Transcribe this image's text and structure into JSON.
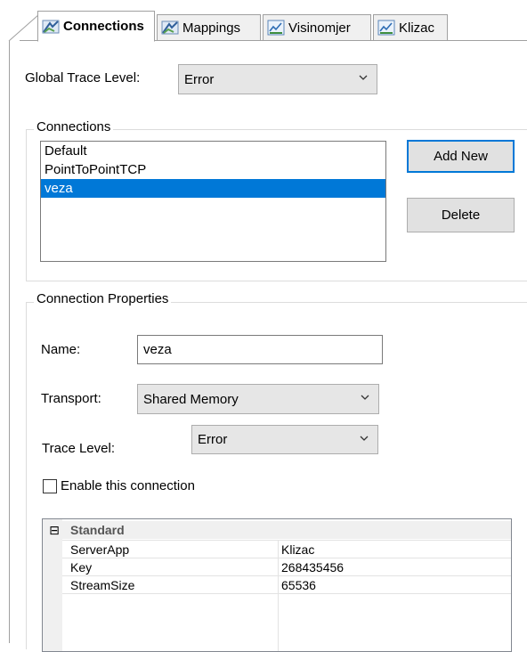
{
  "tabs": [
    {
      "label": "Connections",
      "icon": "connections-icon",
      "active": true
    },
    {
      "label": "Mappings",
      "icon": "connections-icon",
      "active": false
    },
    {
      "label": "Visinomjer",
      "icon": "gauge-icon",
      "active": false
    },
    {
      "label": "Klizac",
      "icon": "gauge-icon",
      "active": false
    }
  ],
  "global_trace": {
    "label": "Global Trace Level:",
    "value": "Error"
  },
  "connections": {
    "title": "Connections",
    "items": [
      "Default",
      "PointToPointTCP",
      "veza"
    ],
    "selected": "veza",
    "add_label": "Add New",
    "delete_label": "Delete"
  },
  "properties": {
    "title": "Connection Properties",
    "name_label": "Name:",
    "name_value": "veza",
    "transport_label": "Transport:",
    "transport_value": "Shared Memory",
    "trace_label": "Trace Level:",
    "trace_value": "Error",
    "enable_label": "Enable this connection",
    "enable_checked": false
  },
  "property_grid": {
    "category": "Standard",
    "expander": "⊟",
    "rows": [
      {
        "name": "ServerApp",
        "value": "Klizac"
      },
      {
        "name": "Key",
        "value": "268435456"
      },
      {
        "name": "StreamSize",
        "value": "65536"
      }
    ]
  },
  "colors": {
    "selection": "#0078d7",
    "default_button_border": "#0078d7"
  }
}
